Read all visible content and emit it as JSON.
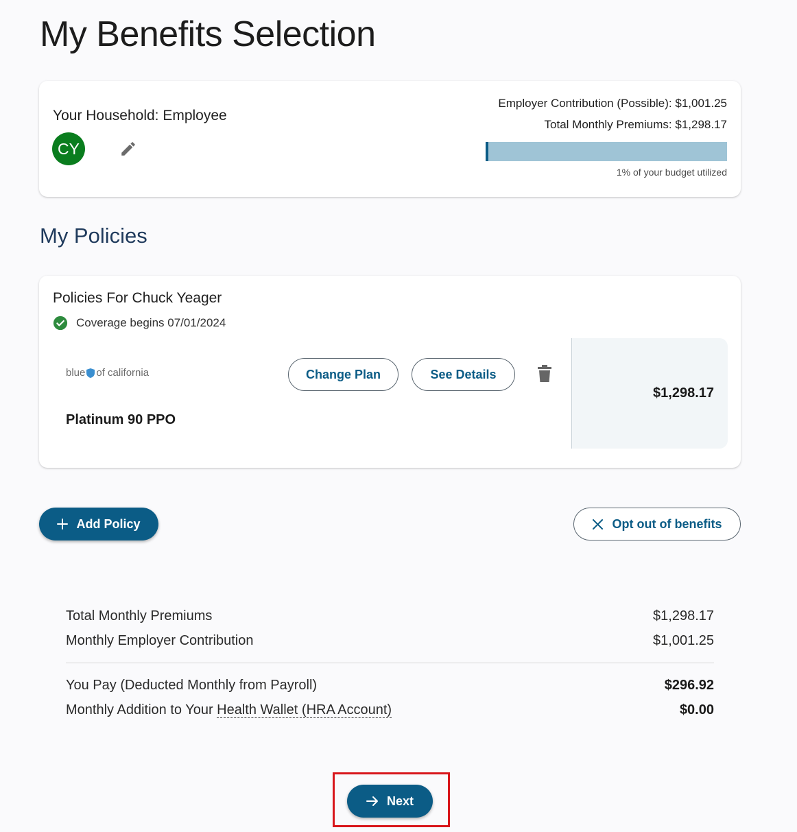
{
  "page": {
    "title": "My Benefits Selection"
  },
  "household": {
    "label": "Your Household: Employee",
    "avatar_initials": "CY",
    "avatar_color": "#0a7d1e",
    "edit_icon": "pencil-icon"
  },
  "budget": {
    "employer_contribution": "Employer Contribution (Possible): $1,001.25",
    "total_premiums": "Total Monthly Premiums: $1,298.17",
    "utilized_percent": 1,
    "note": "1% of your budget utilized"
  },
  "policies": {
    "section_title": "My Policies",
    "heading": "Policies For Chuck Yeager",
    "coverage": "Coverage begins 07/01/2024",
    "items": [
      {
        "carrier_logo_left": "blue",
        "carrier_logo_right": "of california",
        "plan_name": "Platinum 90 PPO",
        "change_plan_label": "Change Plan",
        "see_details_label": "See Details",
        "price": "$1,298.17"
      }
    ]
  },
  "actions": {
    "add_policy_label": "Add Policy",
    "opt_out_label": "Opt out of benefits"
  },
  "summary": {
    "total_premiums_label": "Total Monthly Premiums",
    "total_premiums_value": "$1,298.17",
    "employer_contribution_label": "Monthly Employer Contribution",
    "employer_contribution_value": "$1,001.25",
    "you_pay_label": "You Pay (Deducted Monthly from Payroll)",
    "you_pay_value": "$296.92",
    "hra_label_prefix": "Monthly Addition to Your",
    "hra_link": "Health Wallet (HRA Account)",
    "hra_value": "$0.00"
  },
  "next": {
    "label": "Next"
  },
  "colors": {
    "primary": "#0b5c86",
    "success": "#2e8b3e",
    "highlight": "#d8161b",
    "bar_track": "#9fc4d6"
  }
}
